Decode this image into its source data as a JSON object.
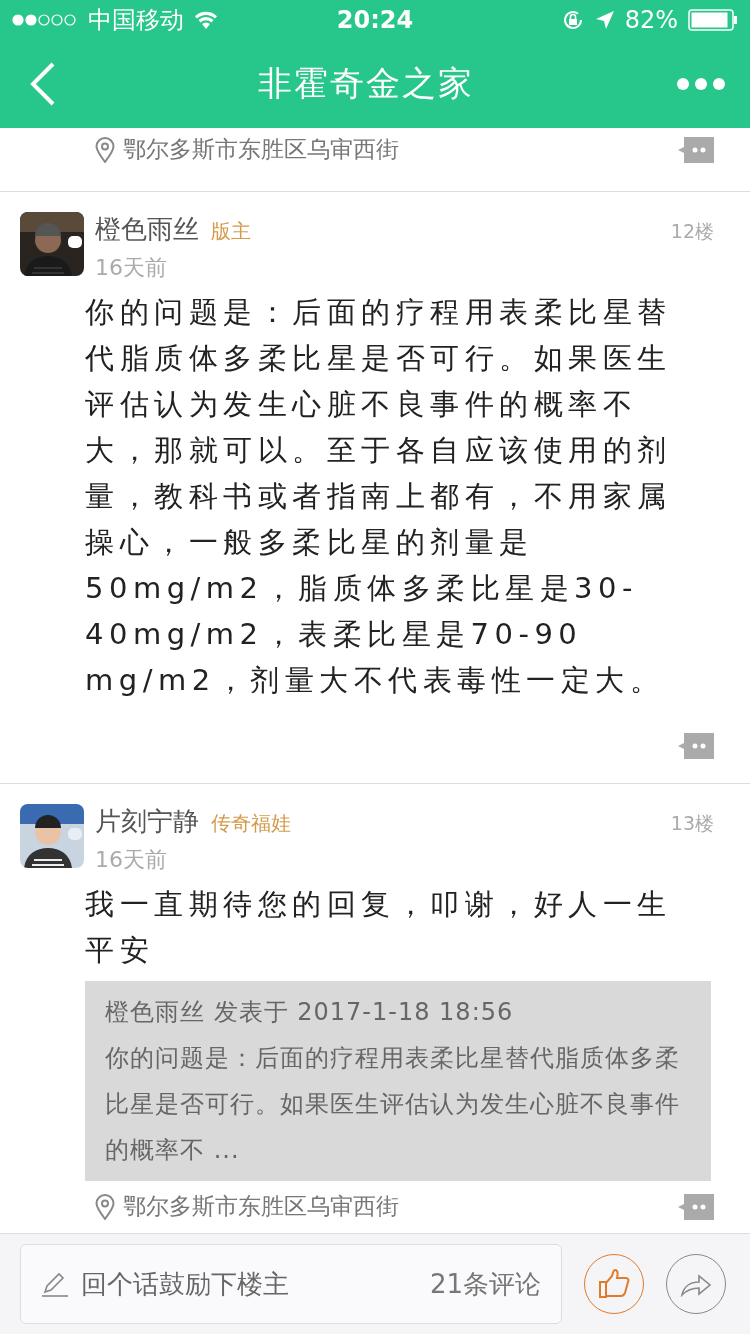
{
  "status_bar": {
    "carrier": "中国移动",
    "time": "20:24",
    "battery": "82%"
  },
  "nav": {
    "title": "非霍奇金之家"
  },
  "posts": [
    {
      "kind": "tail",
      "location": "鄂尔多斯市东胜区乌审西街"
    },
    {
      "kind": "post",
      "author": "橙色雨丝",
      "badge": "版主",
      "floor": "12楼",
      "time": "16天前",
      "body": "你的问题是：后面的疗程用表柔比星替代脂质体多柔比星是否可行。如果医生评估认为发生心脏不良事件的概率不大，那就可以。至于各自应该使用的剂量，教科书或者指南上都有，不用家属操心，一般多柔比星的剂量是50mg/m2，脂质体多柔比星是30-40mg/m2，表柔比星是70-90 mg/m2，剂量大不代表毒性一定大。"
    },
    {
      "kind": "post",
      "author": "片刻宁静",
      "badge": "传奇福娃",
      "floor": "13楼",
      "time": "16天前",
      "body": "我一直期待您的回复，叩谢，好人一生平安",
      "quote": {
        "header": "橙色雨丝 发表于 2017-1-18 18:56",
        "text": "你的问题是：后面的疗程用表柔比星替代脂质体多柔比星是否可行。如果医生评估认为发生心脏不良事件的概率不 ..."
      },
      "location": "鄂尔多斯市东胜区乌审西街"
    }
  ],
  "bottom_bar": {
    "placeholder": "回个话鼓励下楼主",
    "count": "21条评论"
  }
}
